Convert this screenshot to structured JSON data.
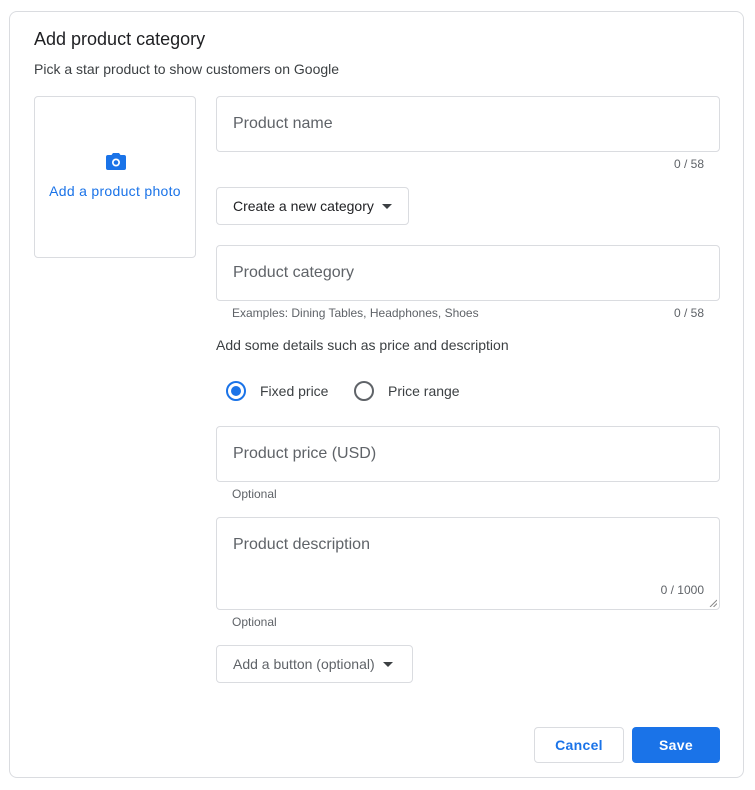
{
  "dialog": {
    "title": "Add product category",
    "subtitle": "Pick a star product to show customers on Google"
  },
  "photo": {
    "icon": "camera-icon",
    "label": "Add a product photo"
  },
  "product_name": {
    "placeholder": "Product name",
    "value": "",
    "counter": "0 / 58"
  },
  "category_dropdown": {
    "label": "Create a new category",
    "icon": "caret-down-icon"
  },
  "product_category": {
    "placeholder": "Product category",
    "value": "",
    "hint": "Examples: Dining Tables, Headphones, Shoes",
    "counter": "0 / 58"
  },
  "details_label": "Add some details such as price and description",
  "price_type": {
    "options": [
      {
        "label": "Fixed price",
        "selected": true
      },
      {
        "label": "Price range",
        "selected": false
      }
    ]
  },
  "product_price": {
    "placeholder": "Product price (USD)",
    "value": "",
    "hint": "Optional"
  },
  "product_description": {
    "placeholder": "Product description",
    "value": "",
    "counter": "0 / 1000",
    "hint": "Optional"
  },
  "button_dropdown": {
    "label": "Add a button (optional)",
    "icon": "caret-down-icon"
  },
  "actions": {
    "cancel_label": "Cancel",
    "save_label": "Save"
  },
  "colors": {
    "accent": "#1a73e8",
    "border": "#dadce0",
    "text": "#3c4043"
  }
}
